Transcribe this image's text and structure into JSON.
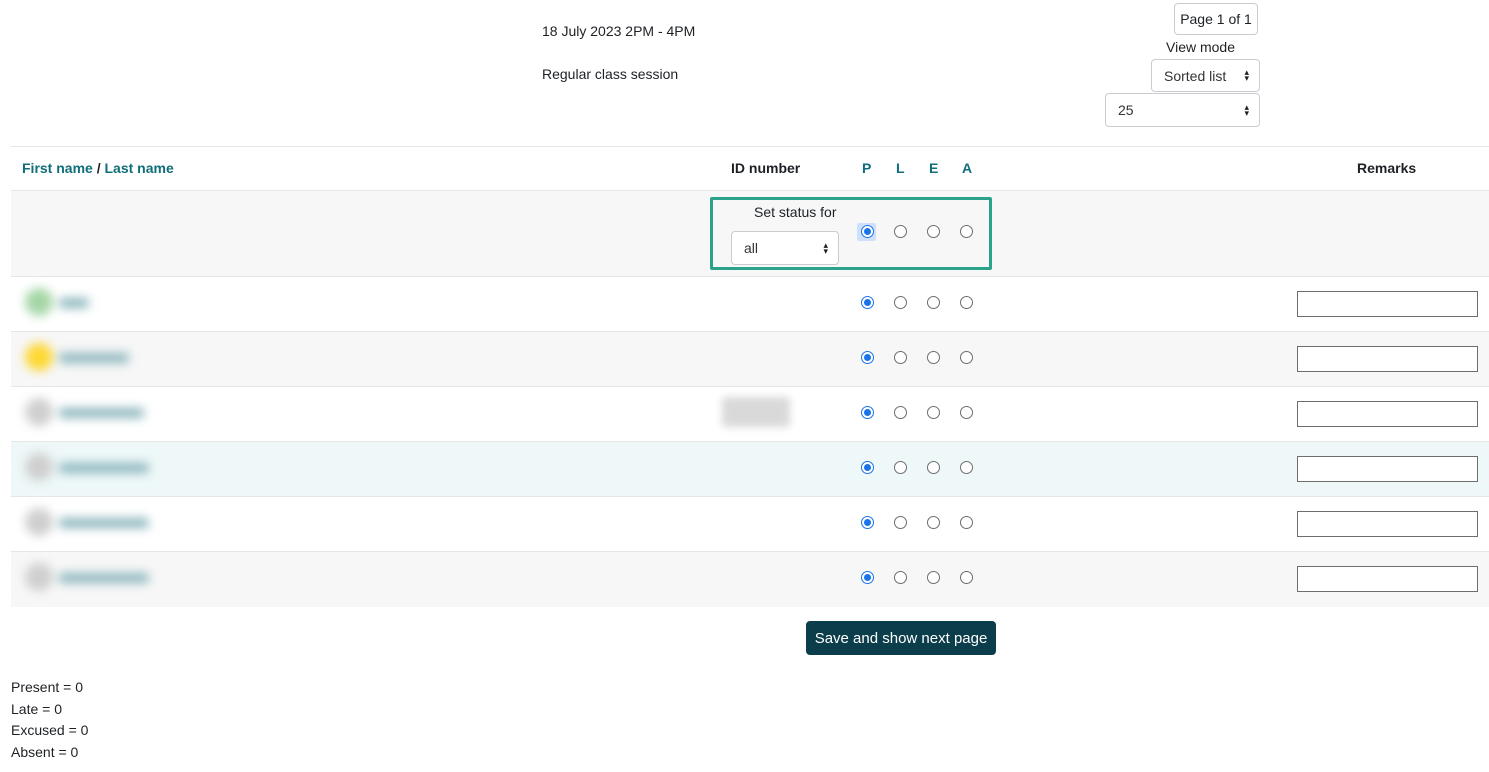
{
  "session": {
    "date": "18 July 2023 2PM - 4PM",
    "description": "Regular class session"
  },
  "pager": {
    "label": "Page 1 of 1"
  },
  "view_mode": {
    "label": "View mode",
    "selected": "Sorted list"
  },
  "per_page": {
    "selected": "25"
  },
  "table": {
    "headers": {
      "first_name": "First name",
      "separator": " / ",
      "last_name": "Last name",
      "id_number": "ID number",
      "statuses": [
        "P",
        "L",
        "E",
        "A"
      ],
      "remarks": "Remarks"
    },
    "set_status": {
      "label": "Set status for",
      "selected": "all",
      "selected_status": "P"
    },
    "rows": [
      {
        "avatar_color": "#a5d6a7",
        "selected_status": "P",
        "remarks": ""
      },
      {
        "avatar_color": "#fdd835",
        "selected_status": "P",
        "remarks": ""
      },
      {
        "avatar_color": "#cfcfcf",
        "selected_status": "P",
        "remarks": ""
      },
      {
        "avatar_color": "#cfcfcf",
        "selected_status": "P",
        "remarks": ""
      },
      {
        "avatar_color": "#cfcfcf",
        "selected_status": "P",
        "remarks": ""
      },
      {
        "avatar_color": "#cfcfcf",
        "selected_status": "P",
        "remarks": ""
      }
    ]
  },
  "save_button": {
    "label": "Save and show next page"
  },
  "summary": {
    "present": "Present = 0",
    "late": "Late = 0",
    "excused": "Excused = 0",
    "absent": "Absent = 0"
  },
  "colors": {
    "link": "#0f6e7a",
    "button": "#0b3d4a",
    "highlight": "#2aa38a",
    "radio_checked": "#1a73e8"
  }
}
